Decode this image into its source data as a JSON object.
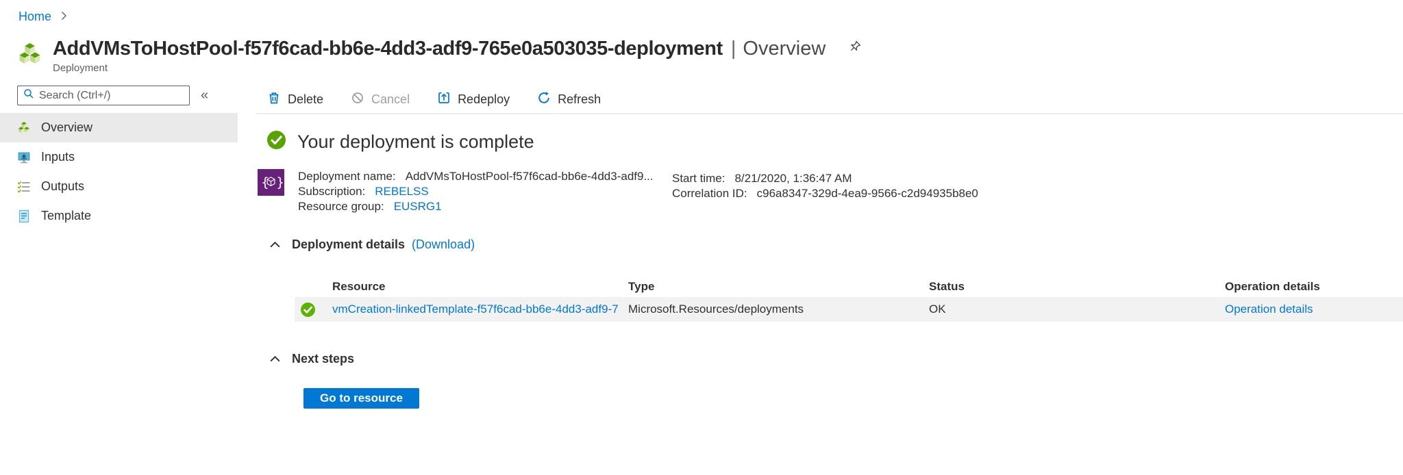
{
  "breadcrumb": {
    "home": "Home"
  },
  "header": {
    "title": "AddVMsToHostPool-f57f6cad-bb6e-4dd3-adf9-765e0a503035-deployment",
    "separator": "|",
    "section": "Overview",
    "subtitle": "Deployment"
  },
  "sidebar": {
    "search_placeholder": "Search (Ctrl+/)",
    "collapse_glyph": "«",
    "items": [
      {
        "label": "Overview",
        "active": true
      },
      {
        "label": "Inputs",
        "active": false
      },
      {
        "label": "Outputs",
        "active": false
      },
      {
        "label": "Template",
        "active": false
      }
    ]
  },
  "toolbar": {
    "items": [
      {
        "label": "Delete",
        "enabled": true
      },
      {
        "label": "Cancel",
        "enabled": false
      },
      {
        "label": "Redeploy",
        "enabled": true
      },
      {
        "label": "Refresh",
        "enabled": true
      }
    ]
  },
  "status": {
    "message": "Your deployment is complete"
  },
  "essentials": {
    "deployment_name_label": "Deployment name:",
    "deployment_name_value": "AddVMsToHostPool-f57f6cad-bb6e-4dd3-adf9...",
    "subscription_label": "Subscription:",
    "subscription_value": "REBELSS",
    "resource_group_label": "Resource group:",
    "resource_group_value": "EUSRG1",
    "start_time_label": "Start time:",
    "start_time_value": "8/21/2020, 1:36:47 AM",
    "correlation_id_label": "Correlation ID:",
    "correlation_id_value": "c96a8347-329d-4ea9-9566-c2d94935b8e0"
  },
  "details_section": {
    "title": "Deployment details",
    "download_link": "(Download)"
  },
  "table": {
    "headers": {
      "resource": "Resource",
      "type": "Type",
      "status": "Status",
      "operation": "Operation details"
    },
    "rows": [
      {
        "resource": "vmCreation-linkedTemplate-f57f6cad-bb6e-4dd3-adf9-7",
        "type": "Microsoft.Resources/deployments",
        "status": "OK",
        "operation": "Operation details"
      }
    ]
  },
  "next_steps": {
    "title": "Next steps",
    "button_label": "Go to resource"
  },
  "colors": {
    "accent": "#0078d4",
    "success_green": "#57a300",
    "arm_purple": "#68217a"
  }
}
